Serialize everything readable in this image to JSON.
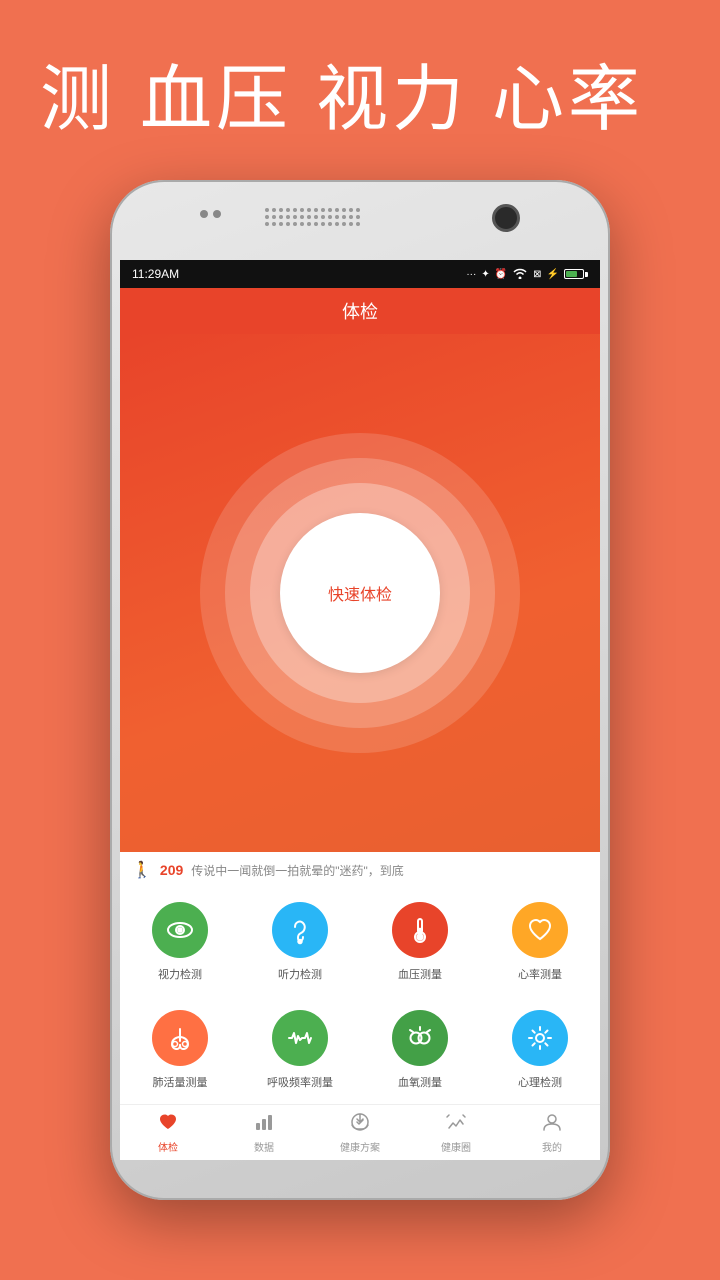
{
  "headline": "测 血压 视力 心率",
  "phone": {
    "status_time": "11:29AM",
    "app_title": "体检",
    "quick_exam": "快速体检",
    "steps_count": "209",
    "news_text": "传说中一闻就倒一拍就晕的\"迷药\"，到底",
    "features": [
      {
        "label": "视力检测",
        "icon": "eye",
        "color": "icon-green"
      },
      {
        "label": "听力检测",
        "icon": "ear",
        "color": "icon-blue"
      },
      {
        "label": "血压测量",
        "icon": "thermometer",
        "color": "icon-red"
      },
      {
        "label": "心率测量",
        "icon": "heart",
        "color": "icon-orange"
      },
      {
        "label": "肺活量测量",
        "icon": "lungs",
        "color": "icon-orange2"
      },
      {
        "label": "呼吸频率测量",
        "icon": "wave",
        "color": "icon-green2"
      },
      {
        "label": "血氧测量",
        "icon": "oxygen",
        "color": "icon-green3"
      },
      {
        "label": "心理检测",
        "icon": "gear",
        "color": "icon-blue2"
      }
    ],
    "nav": [
      {
        "label": "体检",
        "active": true
      },
      {
        "label": "数据",
        "active": false
      },
      {
        "label": "健康方案",
        "active": false
      },
      {
        "label": "健康圈",
        "active": false
      },
      {
        "label": "我的",
        "active": false
      }
    ]
  }
}
